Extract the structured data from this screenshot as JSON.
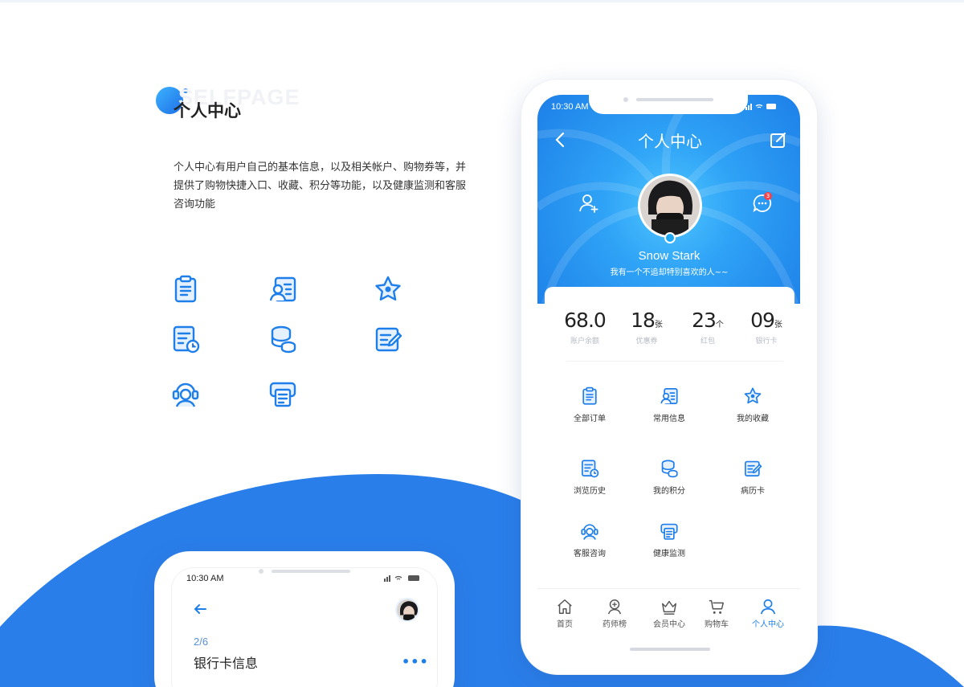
{
  "section": {
    "watermark": "SELFPAGE",
    "title": "个人中心",
    "description": "个人中心有用户自己的基本信息，以及相关帐户、购物券等，并提供了购物快捷入口、收藏、积分等功能，以及健康监测和客服咨询功能"
  },
  "colors": {
    "primary": "#1f7fea",
    "accent_light": "#4fc6ff",
    "badge": "#f5424b"
  },
  "phone": {
    "status_time": "10:30 AM",
    "header": {
      "title": "个人中心",
      "back_icon": "chevron-left-icon",
      "edit_icon": "edit-icon"
    },
    "profile": {
      "name": "Snow Stark",
      "bio": "我有一个不追却特别喜欢的人~~",
      "message_count": "3"
    },
    "stats": [
      {
        "value": "68.0",
        "unit": "",
        "label": "账户余额"
      },
      {
        "value": "18",
        "unit": "张",
        "label": "优惠券"
      },
      {
        "value": "23",
        "unit": "个",
        "label": "红包"
      },
      {
        "value": "09",
        "unit": "张",
        "label": "银行卡"
      }
    ],
    "menu": [
      {
        "label": "全部订单",
        "icon": "clipboard-icon"
      },
      {
        "label": "常用信息",
        "icon": "profile-card-icon"
      },
      {
        "label": "我的收藏",
        "icon": "star-icon"
      },
      {
        "label": "浏览历史",
        "icon": "history-icon"
      },
      {
        "label": "我的积分",
        "icon": "coins-icon"
      },
      {
        "label": "病历卡",
        "icon": "medical-record-icon"
      },
      {
        "label": "客服咨询",
        "icon": "headset-icon"
      },
      {
        "label": "健康监测",
        "icon": "monitor-icon"
      }
    ],
    "tabs": [
      {
        "label": "首页",
        "icon": "home-icon"
      },
      {
        "label": "药师榜",
        "icon": "pharmacist-icon"
      },
      {
        "label": "会员中心",
        "icon": "crown-icon"
      },
      {
        "label": "购物车",
        "icon": "cart-icon"
      },
      {
        "label": "个人中心",
        "icon": "user-icon",
        "active": true
      }
    ]
  },
  "small_phone": {
    "status_time": "10:30 AM",
    "step": "2/6",
    "card_title": "银行卡信息",
    "more": "•••"
  }
}
